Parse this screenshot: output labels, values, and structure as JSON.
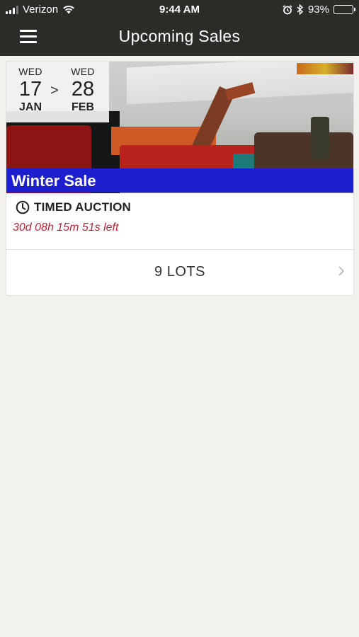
{
  "status_bar": {
    "carrier": "Verizon",
    "time": "9:44 AM",
    "battery": "93%",
    "battery_level": 0.93,
    "icons": [
      "signal-icon",
      "wifi-icon",
      "alarm-icon",
      "bluetooth-icon",
      "battery-icon"
    ]
  },
  "nav": {
    "title": "Upcoming Sales",
    "menu_icon": "hamburger-menu-icon"
  },
  "sale": {
    "start": {
      "dow": "WED",
      "day": "17",
      "month": "JAN"
    },
    "separator": ">",
    "end": {
      "dow": "WED",
      "day": "28",
      "month": "FEB"
    },
    "name": "Winter Sale",
    "type": "TIMED AUCTION",
    "time_left": "30d 08h 15m 51s left",
    "lots": "9 LOTS"
  },
  "colors": {
    "bar_background": "#2b2b27",
    "banner_blue": "#1d1fcf",
    "countdown_red": "#b8263a",
    "page_background": "#f2f1ee"
  }
}
